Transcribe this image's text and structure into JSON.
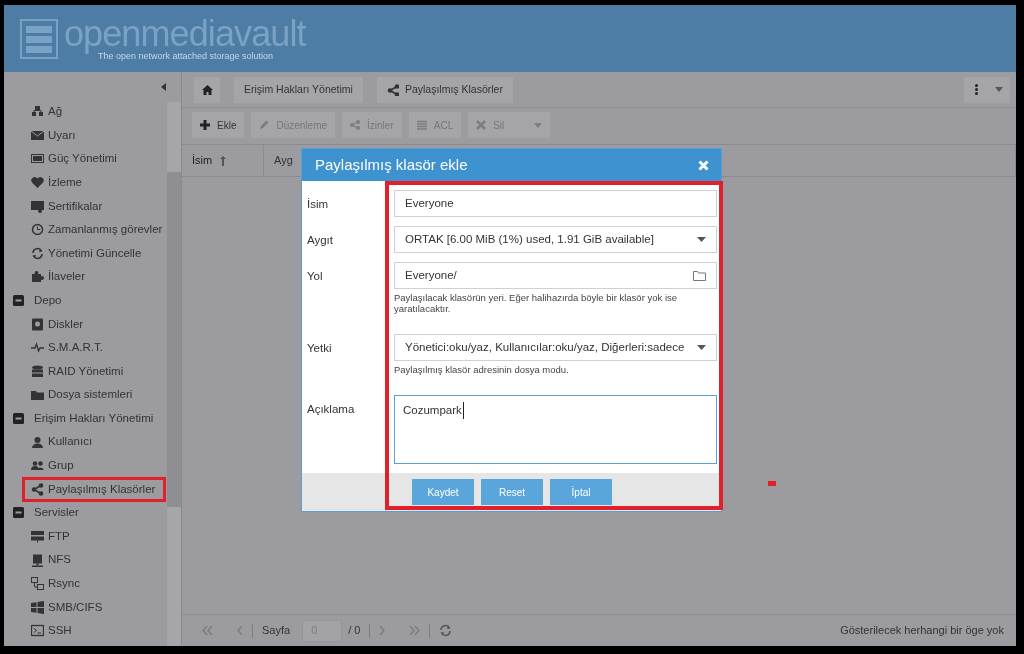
{
  "header": {
    "logo_text": "openmediavault",
    "tagline": "The open network attached storage solution"
  },
  "breadcrumb": [
    "Erişim Hakları Yönetimi",
    "Paylaşılmış Klasörler"
  ],
  "sidebar": {
    "groups": [
      {
        "children": [
          {
            "label": "Ağ"
          },
          {
            "label": "Uyarı"
          },
          {
            "label": "Güç Yönetimi"
          },
          {
            "label": "İzleme"
          },
          {
            "label": "Sertifikalar"
          },
          {
            "label": "Zamanlanmış görevler"
          },
          {
            "label": "Yönetimi Güncelle"
          },
          {
            "label": "İlaveler"
          }
        ]
      },
      {
        "label": "Depo",
        "expanded": true,
        "children": [
          {
            "label": "Diskler"
          },
          {
            "label": "S.M.A.R.T."
          },
          {
            "label": "RAID Yönetimi"
          },
          {
            "label": "Dosya sistemleri"
          }
        ]
      },
      {
        "label": "Erişim Hakları Yönetimi",
        "expanded": true,
        "children": [
          {
            "label": "Kullanıcı"
          },
          {
            "label": "Grup"
          },
          {
            "label": "Paylaşılmış Klasörler"
          }
        ]
      },
      {
        "label": "Servisler",
        "expanded": true,
        "children": [
          {
            "label": "FTP"
          },
          {
            "label": "NFS"
          },
          {
            "label": "Rsync"
          },
          {
            "label": "SMB/CIFS"
          },
          {
            "label": "SSH"
          }
        ]
      }
    ]
  },
  "toolbar": [
    {
      "label": "Ekle",
      "disabled": false
    },
    {
      "label": "Düzenleme",
      "disabled": true
    },
    {
      "label": "İzinler",
      "disabled": true
    },
    {
      "label": "ACL",
      "disabled": true
    },
    {
      "label": "Sil",
      "disabled": true
    }
  ],
  "grid": {
    "columns": [
      {
        "label": "İsim",
        "sorted": true
      },
      {
        "label": "Ayg",
        "sorted": false
      }
    ]
  },
  "pager": {
    "page_label": "Sayfa",
    "page_value": "0",
    "page_total": "/ 0",
    "status": "Gösterilecek herhangi bir öge yok"
  },
  "dialog": {
    "title": "Paylaşılmış klasör ekle",
    "fields": [
      {
        "kind": "text",
        "label": "İsim",
        "value": "Everyone"
      },
      {
        "kind": "select",
        "label": "Aygıt",
        "value": "ORTAK [6.00 MiB (1%) used, 1.91 GiB available]"
      },
      {
        "kind": "folder",
        "label": "Yol",
        "value": "Everyone/",
        "help": "Paylaşılacak klasörün yeri. Eğer halihazırda böyle bir klasör yok ise yaratılacaktır."
      },
      {
        "kind": "select",
        "label": "Yetki",
        "value": "Yönetici:oku/yaz, Kullanıcılar:oku/yaz, Diğerleri:sadece",
        "help": "Paylaşılmış klasör adresinin dosya modu."
      },
      {
        "kind": "textarea",
        "label": "Açıklama",
        "value": "Cozumpark"
      }
    ],
    "buttons": [
      "Kaydet",
      "Reset",
      "İptal"
    ]
  }
}
